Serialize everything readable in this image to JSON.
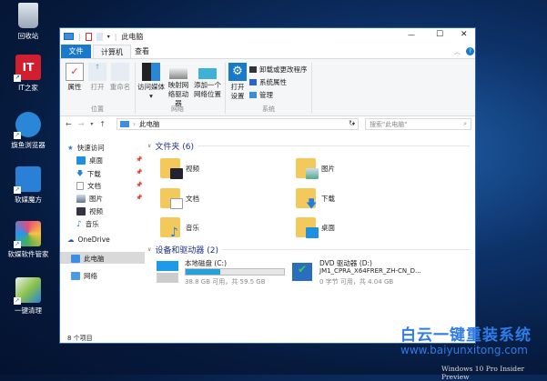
{
  "desktop": {
    "icons": [
      {
        "label": "回收站"
      },
      {
        "label": "IT之家",
        "glyph": "IT"
      },
      {
        "label": "旗鱼浏览器"
      },
      {
        "label": "软媒魔方"
      },
      {
        "label": "软媒软件管家"
      },
      {
        "label": "一键清理"
      }
    ]
  },
  "window": {
    "title": "此电脑",
    "controls": {
      "minimize": "—",
      "maximize": "☐",
      "close": "✕"
    },
    "tabs": [
      {
        "label": "文件"
      },
      {
        "label": "计算机"
      },
      {
        "label": "查看"
      }
    ],
    "ribbon": {
      "location": {
        "label": "位置",
        "buttons": [
          "属性",
          "打开",
          "重命名"
        ]
      },
      "network": {
        "label": "网络",
        "buttons": [
          "访问媒体",
          "映射网络驱动器",
          "添加一个网络位置"
        ]
      },
      "system": {
        "label": "系统",
        "open_settings": "打开设置",
        "items": [
          "卸载或更改程序",
          "系统属性",
          "管理"
        ]
      }
    },
    "address": {
      "path": "此电脑",
      "search_placeholder": "搜索\"此电脑\""
    },
    "sidebar": {
      "quick_access": "快速访问",
      "items": [
        "桌面",
        "下载",
        "文档",
        "图片",
        "视频",
        "音乐"
      ],
      "onedrive": "OneDrive",
      "this_pc": "此电脑",
      "network": "网络"
    },
    "folders": {
      "header": "文件夹 (6)",
      "items": [
        "视频",
        "图片",
        "文档",
        "下载",
        "音乐",
        "桌面"
      ]
    },
    "devices": {
      "header": "设备和驱动器 (2)",
      "items": [
        {
          "name": "本地磁盘 (C:)",
          "space": "38.8 GB 可用，共 59.5 GB",
          "used_fraction": 0.35
        },
        {
          "name": "DVD 驱动器 (D:)",
          "label": "JM1_CPRA_X64FRER_ZH-CN_D...",
          "space": "0 字节 可用，共 4.04 GB"
        }
      ]
    },
    "status": "8 个项目"
  },
  "watermark": {
    "title": "白云一键重装系统",
    "url": "www.baiyunxitong.com"
  },
  "os_label": "Windows 10 Pro Insider Preview"
}
